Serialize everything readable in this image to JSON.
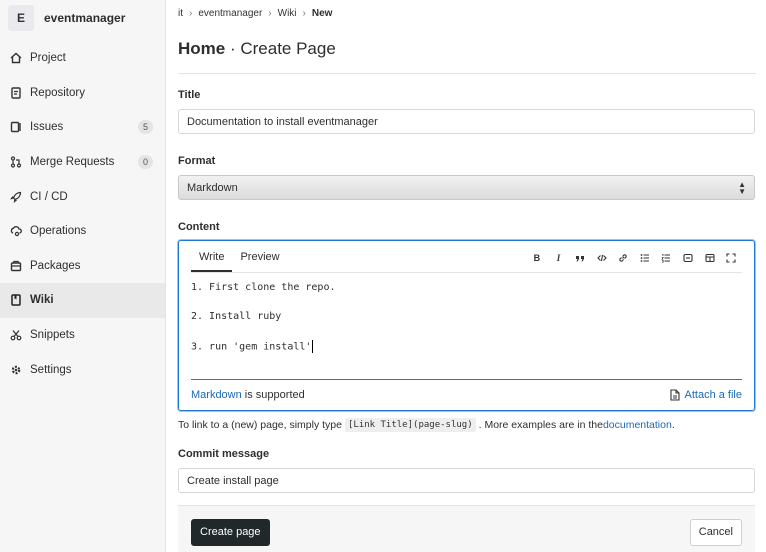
{
  "project": {
    "avatar_letter": "E",
    "name": "eventmanager"
  },
  "sidebar": {
    "items": [
      {
        "label": "Project",
        "icon": "home-icon"
      },
      {
        "label": "Repository",
        "icon": "doc-icon"
      },
      {
        "label": "Issues",
        "icon": "issues-icon",
        "badge": "5"
      },
      {
        "label": "Merge Requests",
        "icon": "merge-request-icon",
        "badge": "0"
      },
      {
        "label": "CI / CD",
        "icon": "rocket-icon"
      },
      {
        "label": "Operations",
        "icon": "cloud-gear-icon"
      },
      {
        "label": "Packages",
        "icon": "package-icon"
      },
      {
        "label": "Wiki",
        "icon": "book-icon",
        "active": true
      },
      {
        "label": "Snippets",
        "icon": "scissors-icon"
      },
      {
        "label": "Settings",
        "icon": "gear-icon"
      }
    ]
  },
  "breadcrumb": {
    "items": [
      "it",
      "eventmanager",
      "Wiki"
    ],
    "current": "New",
    "separator": "›"
  },
  "header": {
    "title_strong": "Home",
    "title_rest": " · Create Page"
  },
  "form": {
    "title_label": "Title",
    "title_value": "Documentation to install eventmanager",
    "format_label": "Format",
    "format_value": "Markdown",
    "content_label": "Content",
    "tabs": {
      "write": "Write",
      "preview": "Preview"
    },
    "toolbar": [
      "B",
      "I",
      "quote-icon",
      "code-icon",
      "link-icon",
      "bullet-list-icon",
      "numbered-list-icon",
      "task-list-icon",
      "table-icon",
      "fullscreen-icon"
    ],
    "content_lines": [
      "1. First clone the repo.",
      "2. Install ruby",
      "3. run 'gem install'"
    ],
    "markdown_link": "Markdown",
    "markdown_suffix": " is supported",
    "attach_label": "Attach a file",
    "help_prefix": "To link to a (new) page, simply type ",
    "help_code": "[Link Title](page-slug)",
    "help_middle": ". More examples are in the ",
    "help_link": "documentation",
    "help_end": ".",
    "commit_label": "Commit message",
    "commit_value": "Create install page"
  },
  "actions": {
    "create": "Create page",
    "cancel": "Cancel"
  },
  "colors": {
    "accent": "#1f78d1",
    "link": "#1b69b6",
    "primary_button": "#21282a"
  }
}
